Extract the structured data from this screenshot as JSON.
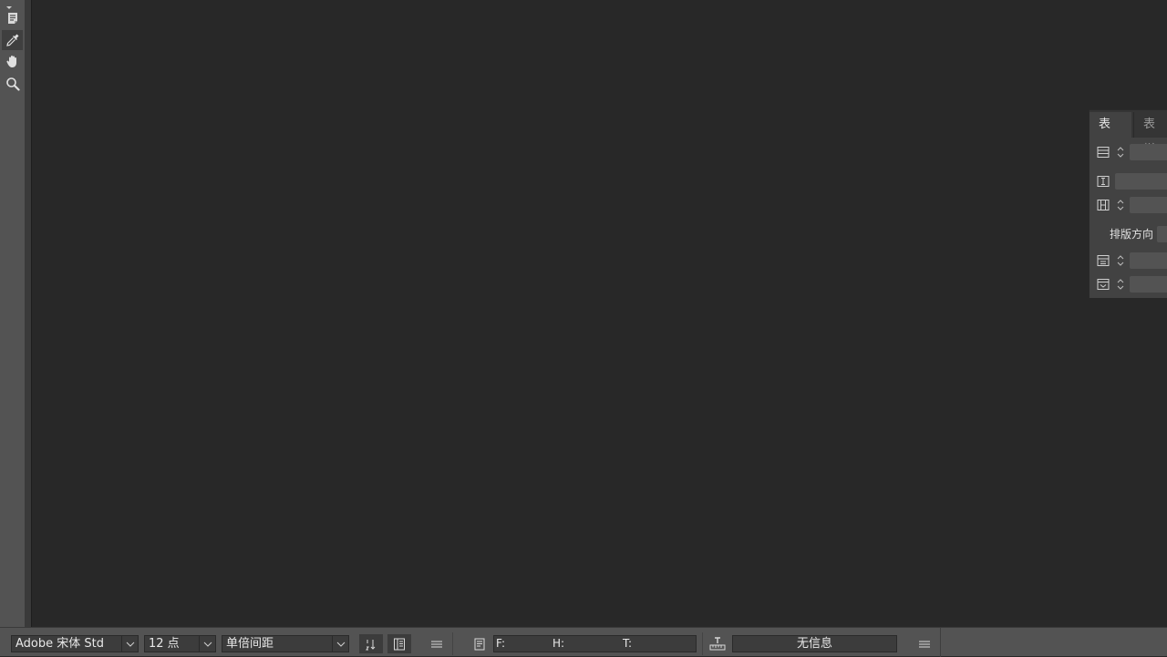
{
  "toolbar": {
    "tools": [
      "note-icon",
      "eyedropper-icon",
      "hand-icon",
      "zoom-icon"
    ],
    "active_tool": "eyedropper-icon"
  },
  "table_panel": {
    "tabs": [
      "表",
      "表样"
    ],
    "orientation_label": "排版方向"
  },
  "bottom_bar": {
    "font_family": "Adobe 宋体 Std",
    "font_size": "12 点",
    "line_spacing": "单倍间距",
    "f_label": "F:",
    "h_label": "H:",
    "t_label": "T:",
    "info": "无信息"
  },
  "colors": {
    "canvas": "#282828",
    "toolbar": "#535353",
    "panel": "#424242"
  }
}
